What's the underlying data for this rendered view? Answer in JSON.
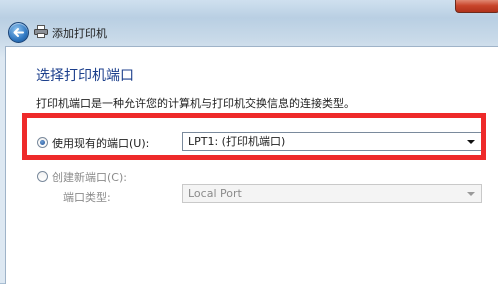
{
  "window": {
    "title": "添加打印机",
    "accent": "#1c3f8c"
  },
  "page": {
    "heading": "选择打印机端口",
    "description": "打印机端口是一种允许您的计算机与打印机交换信息的连接类型。"
  },
  "options": {
    "use_existing": {
      "label": "使用现有的端口(U):",
      "selected": true,
      "value": "LPT1: (打印机端口)"
    },
    "create_new": {
      "label": "创建新端口(C):",
      "selected": false,
      "port_type_label": "端口类型:",
      "port_type_value": "Local Port"
    }
  },
  "annotation": {
    "highlight_color": "#ee2a2a"
  }
}
